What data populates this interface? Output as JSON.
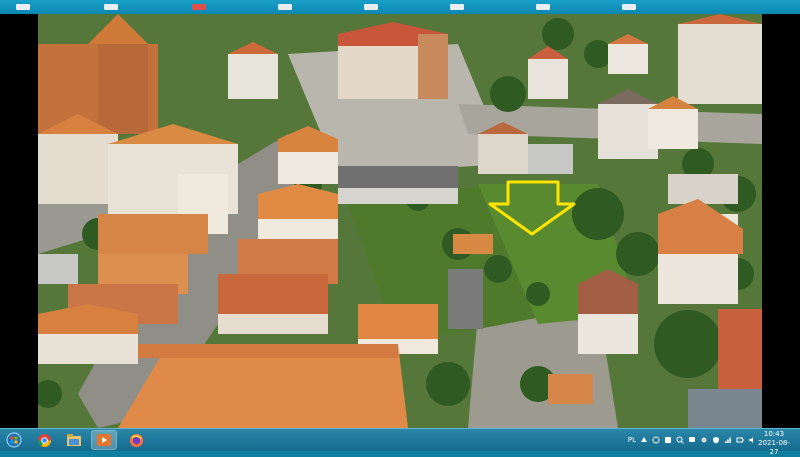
{
  "window": {
    "top_strip_icons": [
      "app-icon",
      "app-icon",
      "app-icon",
      "app-icon",
      "app-icon",
      "app-icon",
      "app-icon",
      "app-icon"
    ]
  },
  "video": {
    "content": "aerial-town-photo",
    "annotation": {
      "type": "arrow",
      "direction": "down",
      "color": "#ffe400"
    }
  },
  "taskbar": {
    "apps": [
      {
        "icon": "windows-start-icon"
      },
      {
        "icon": "chrome-icon"
      },
      {
        "icon": "explorer-icon"
      },
      {
        "icon": "media-player-icon",
        "active": true
      },
      {
        "icon": "firefox-icon"
      }
    ],
    "language": "PL",
    "time": "10:43",
    "date": "2021-08-27"
  },
  "colors": {
    "taskbar": "#146c8f",
    "arrow": "#ffe400",
    "roof": "#e0813f"
  }
}
